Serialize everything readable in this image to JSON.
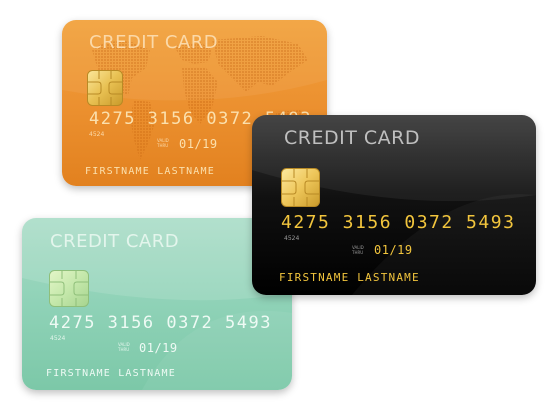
{
  "cards": {
    "orange": {
      "title": "CREDIT CARD",
      "number": "4275 3156 0372 5493",
      "bin_code": "4524",
      "valid_thru_line1": "VALID",
      "valid_thru_line2": "THRU",
      "expiry": "01/19",
      "holder": "FIRSTNAME LASTNAME",
      "color": "#ec9130"
    },
    "black": {
      "title": "CREDIT CARD",
      "number": "4275 3156 0372 5493",
      "bin_code": "4524",
      "valid_thru_line1": "VALID",
      "valid_thru_line2": "THRU",
      "expiry": "01/19",
      "holder": "FIRSTNAME LASTNAME",
      "color": "#111111"
    },
    "green": {
      "title": "CREDIT CARD",
      "number": "4275 3156 0372 5493",
      "bin_code": "4524",
      "valid_thru_line1": "VALID",
      "valid_thru_line2": "THRU",
      "expiry": "01/19",
      "holder": "FIRSTNAME LASTNAME",
      "color": "#8fd2b7"
    }
  }
}
